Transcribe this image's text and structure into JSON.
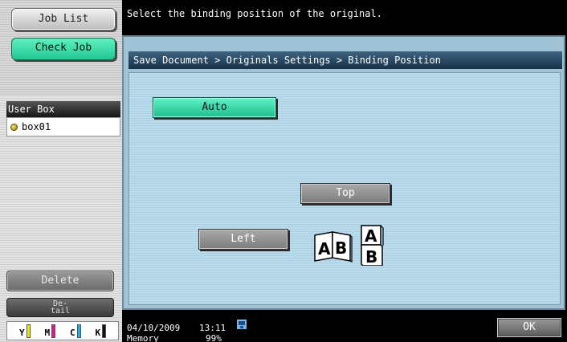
{
  "sidebar": {
    "job_list_label": "Job List",
    "check_job_label": "Check Job",
    "user_box_header": "User Box",
    "user_box_items": [
      {
        "label": "box01",
        "icon": "box-icon"
      }
    ],
    "delete_label": "Delete",
    "detail_label_line1": "De-",
    "detail_label_line2": "tail",
    "toner": [
      {
        "label": "Y",
        "color": "#f3e21c"
      },
      {
        "label": "M",
        "color": "#e2168f"
      },
      {
        "label": "C",
        "color": "#19b4e8"
      },
      {
        "label": "K",
        "color": "#111111"
      }
    ]
  },
  "message": "Select the binding position of the original.",
  "breadcrumb": "Save Document > Originals Settings > Binding Position",
  "options": {
    "auto_label": "Auto",
    "top_label": "Top",
    "left_label": "Left",
    "selected": "Auto"
  },
  "illustration": {
    "letters": [
      "A",
      "B",
      "A",
      "B"
    ]
  },
  "status": {
    "date": "04/10/2009",
    "time": "13:11",
    "memory_label": "Memory",
    "memory_value": "99%",
    "ok_label": "OK"
  },
  "colors": {
    "accent_green": "#2fd6a0",
    "panel_blue": "#b3d6e8",
    "header_navy": "#1f3d57"
  }
}
